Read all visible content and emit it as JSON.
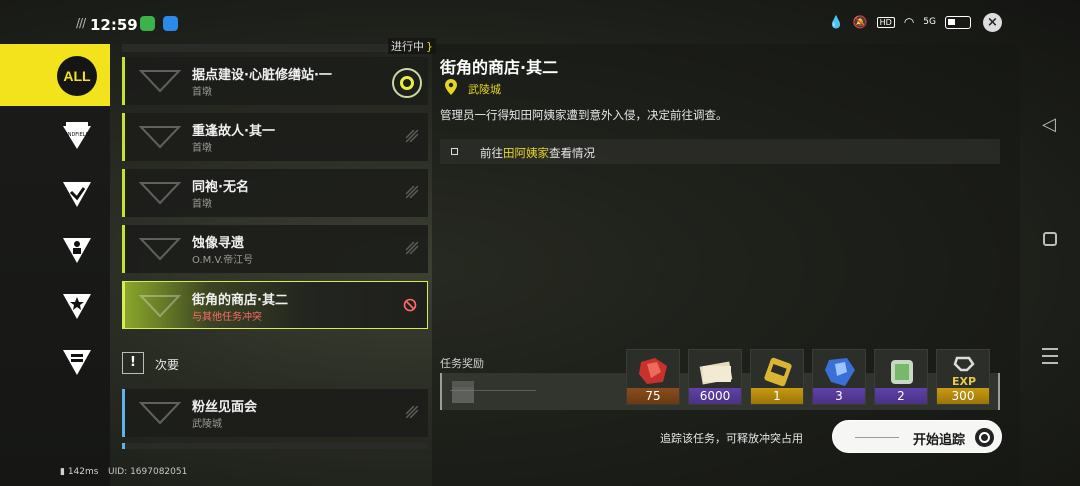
{
  "status_bar": {
    "time": "12:59",
    "slashes": "///",
    "network": "5G"
  },
  "in_progress_label": "进行中",
  "categories": [
    {
      "name": "ALL",
      "active": true
    },
    {
      "name": "endfield-icon"
    },
    {
      "name": "branch-icon"
    },
    {
      "name": "person-icon"
    },
    {
      "name": "star-icon"
    },
    {
      "name": "crown-icon"
    }
  ],
  "quests": [
    {
      "title": "据点建设·心脏修缮站·一",
      "subtitle": "首墩",
      "tracked": true
    },
    {
      "title": "重逢故人·其一",
      "subtitle": "首墩"
    },
    {
      "title": "同袍·无名",
      "subtitle": "首墩"
    },
    {
      "title": "蚀像寻遗",
      "subtitle": "O.M.V.帝江号"
    },
    {
      "title": "街角的商店·其二",
      "subtitle": "与其他任务冲突",
      "active": true
    }
  ],
  "secondary": {
    "icon": "!",
    "label": "次要",
    "quests": [
      {
        "title": "粉丝见面会",
        "subtitle": "武陵城"
      }
    ]
  },
  "detail": {
    "title": "街角的商店·其二",
    "location": "武陵城",
    "description": "管理员一行得知田阿姨家遭到意外入侵，决定前往调查。",
    "objective_prefix": "前往",
    "objective_highlight": "田阿姨家",
    "objective_suffix": "查看情况"
  },
  "rewards": {
    "label": "任务奖励",
    "items": [
      {
        "count": "75",
        "tier": "orange",
        "icon": "red-crystal-icon"
      },
      {
        "count": "6000",
        "tier": "purple",
        "icon": "money-bills-icon"
      },
      {
        "count": "1",
        "tier": "gold",
        "icon": "gold-battery-icon"
      },
      {
        "count": "3",
        "tier": "purple",
        "icon": "blue-crystal-icon"
      },
      {
        "count": "2",
        "tier": "purple",
        "icon": "green-capsule-icon"
      },
      {
        "count": "300",
        "tier": "gold",
        "icon": "exp-icon",
        "text": "EXP"
      }
    ]
  },
  "track_hint": "追踪该任务，可释放冲突占用",
  "start_button": "开始追踪",
  "footer": {
    "ping": "142ms",
    "uid": "UID: 1697082051"
  },
  "colors": {
    "accent_yellow": "#f3e31c",
    "active_green": "#c6e230",
    "conflict_red": "#ff6b6b",
    "secondary_blue": "#5fb3e6"
  }
}
